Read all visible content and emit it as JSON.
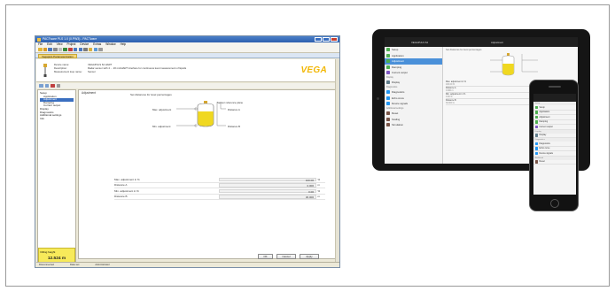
{
  "pactware": {
    "title": "PACTware PLS 1.0 (0.PW3) - PACTware",
    "menu": [
      "File",
      "Edit",
      "View",
      "Project",
      "Device",
      "Extras",
      "Window",
      "Help"
    ],
    "subtab": "Vegapuls Parameterization",
    "header": {
      "labels": [
        "Device name:",
        "Description:",
        "Measurement loop name:"
      ],
      "values": [
        "VEGAPULS 64 HART",
        "Radar sensor with 4 ... 20 mA/HART interface for continuous level measurement of liquids",
        "Sensor"
      ]
    },
    "brand": "VEGA",
    "tree": [
      {
        "label": "Setup",
        "level": 0
      },
      {
        "label": "Application",
        "level": 1
      },
      {
        "label": "Adjustment",
        "level": 1,
        "selected": true
      },
      {
        "label": "Damping",
        "level": 1
      },
      {
        "label": "Current output",
        "level": 1
      },
      {
        "label": "Display",
        "level": 0
      },
      {
        "label": "Diagnostics",
        "level": 0
      },
      {
        "label": "Additional settings",
        "level": 0
      },
      {
        "label": "Info",
        "level": 0
      }
    ],
    "measured": {
      "label": "Filling height",
      "value": "12.524 m"
    },
    "content": {
      "title": "Adjustment",
      "distance_label": "Set distances for level percentages",
      "srp": "Sensor reference plane",
      "max_adj": "Max. adjustment",
      "min_adj": "Min. adjustment",
      "dist_a": "Distance A",
      "dist_b": "Distance B",
      "rows": [
        {
          "k": "Max. adjustment in %",
          "v": "100.00",
          "u": "%"
        },
        {
          "k": "Distance A",
          "v": "0.000",
          "u": "m"
        },
        {
          "k": "Min. adjustment in %",
          "v": "0.00",
          "u": "%"
        },
        {
          "k": "Distance B",
          "v": "30.000",
          "u": "m"
        }
      ],
      "buttons": [
        "OK",
        "Cancel",
        "Apply"
      ]
    },
    "status": [
      "Disconnected",
      "Data set",
      "Administrator"
    ]
  },
  "tablet": {
    "app_title": "VEGAPULS 64",
    "screen_title": "Adjustment",
    "sidebar": [
      {
        "type": "item",
        "label": "Setup",
        "color": "#4caf50"
      },
      {
        "type": "item",
        "label": "Application",
        "color": "#4caf50"
      },
      {
        "type": "item",
        "label": "Adjustment",
        "color": "#4caf50",
        "selected": true
      },
      {
        "type": "item",
        "label": "Damping",
        "color": "#4caf50"
      },
      {
        "type": "item",
        "label": "Current output",
        "color": "#7e57c2"
      },
      {
        "type": "section",
        "label": "Display"
      },
      {
        "type": "item",
        "label": "Display",
        "color": "#607d8b"
      },
      {
        "type": "section",
        "label": "Diagnostics"
      },
      {
        "type": "item",
        "label": "Diagnostics",
        "color": "#2196f3"
      },
      {
        "type": "item",
        "label": "Echo curve",
        "color": "#2196f3"
      },
      {
        "type": "item",
        "label": "Device signals",
        "color": "#2196f3"
      },
      {
        "type": "section",
        "label": "Additional settings"
      },
      {
        "type": "item",
        "label": "Reset",
        "color": "#795548"
      },
      {
        "type": "item",
        "label": "Scaling",
        "color": "#795548"
      },
      {
        "type": "item",
        "label": "Simulation",
        "color": "#795548"
      }
    ],
    "main": {
      "heading": "Set distances for level percentages",
      "rows": [
        {
          "k": "Max. adjustment in %",
          "v": "100.00 %"
        },
        {
          "k": "Distance A",
          "v": "0.000 m"
        },
        {
          "k": "Min. adjustment in %",
          "v": "0.00 %"
        },
        {
          "k": "Distance B",
          "v": "30.000 m"
        }
      ]
    }
  },
  "phone": {
    "items": [
      {
        "type": "section",
        "label": "Setup"
      },
      {
        "type": "item",
        "label": "Setup",
        "color": "#4caf50"
      },
      {
        "type": "item",
        "label": "Application",
        "color": "#4caf50"
      },
      {
        "type": "item",
        "label": "Adjustment",
        "color": "#4caf50"
      },
      {
        "type": "item",
        "label": "Damping",
        "color": "#4caf50"
      },
      {
        "type": "item",
        "label": "Current output",
        "color": "#7e57c2"
      },
      {
        "type": "section",
        "label": "Display"
      },
      {
        "type": "item",
        "label": "Display",
        "color": "#607d8b"
      },
      {
        "type": "section",
        "label": "Diagnostics"
      },
      {
        "type": "item",
        "label": "Diagnostics",
        "color": "#2196f3"
      },
      {
        "type": "item",
        "label": "Echo curve",
        "color": "#2196f3"
      },
      {
        "type": "item",
        "label": "Device signals",
        "color": "#2196f3"
      },
      {
        "type": "section",
        "label": "Additional"
      },
      {
        "type": "item",
        "label": "Reset",
        "color": "#795548"
      }
    ]
  }
}
